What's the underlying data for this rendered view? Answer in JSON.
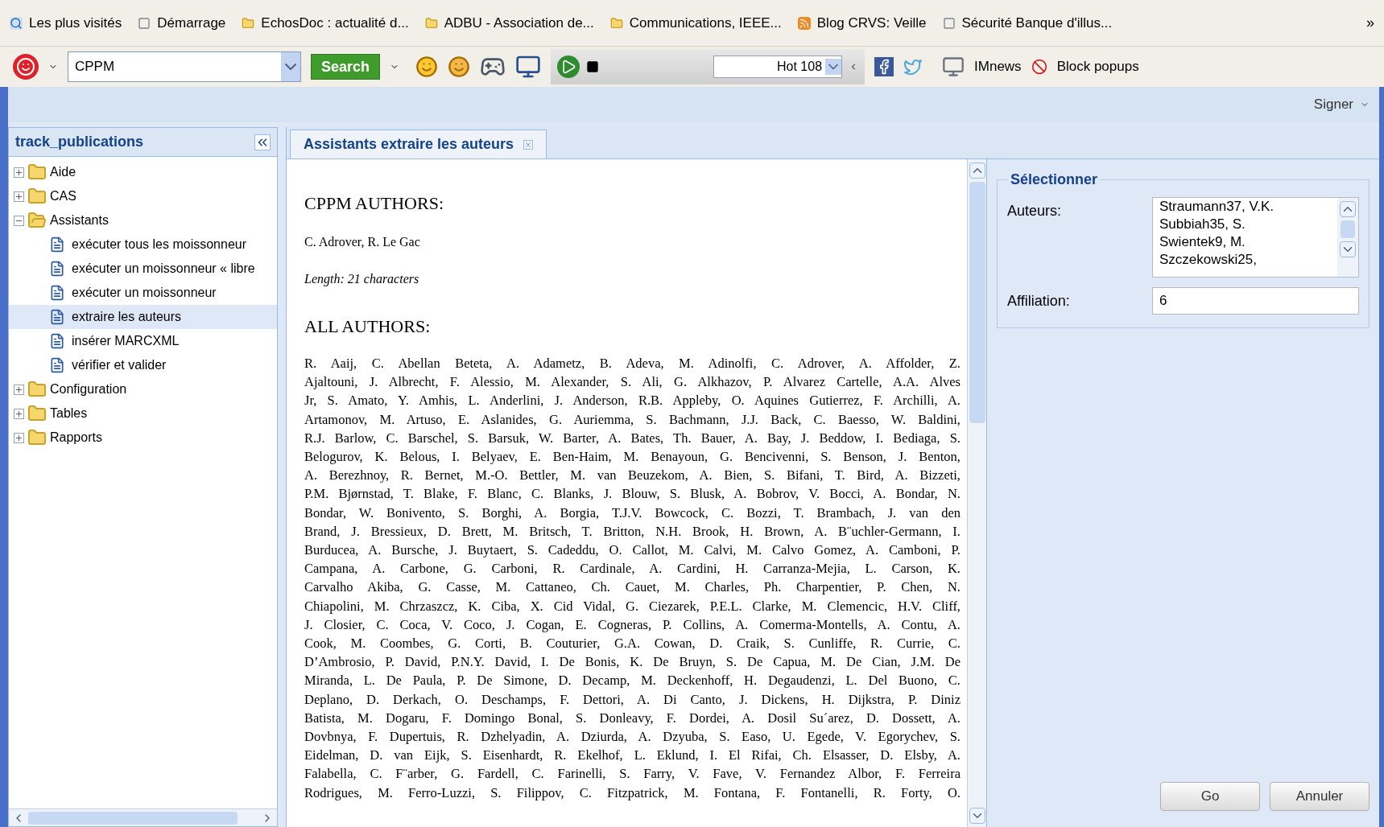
{
  "bookmarks": [
    {
      "kind": "search",
      "label": "Les plus visités"
    },
    {
      "kind": "blank",
      "label": "Démarrage"
    },
    {
      "kind": "folder",
      "label": "EchosDoc : actualité d..."
    },
    {
      "kind": "folder",
      "label": "ADBU - Association de..."
    },
    {
      "kind": "folder",
      "label": "Communications, IEEE..."
    },
    {
      "kind": "rss",
      "label": "Blog CRVS: Veille"
    },
    {
      "kind": "blank",
      "label": "Sécurité Banque d'illus..."
    }
  ],
  "bookmarks_overflow": "»",
  "toolbar": {
    "search_value": "CPPM",
    "search_button": "Search",
    "hot_value": "Hot 108",
    "imnews": "IMnews",
    "block_popups": "Block popups"
  },
  "user_menu": "Signer",
  "sidebar": {
    "title": "track_publications",
    "items": [
      {
        "label": "Aide",
        "expanded": false,
        "selected": false
      },
      {
        "label": "CAS",
        "expanded": false,
        "selected": false
      },
      {
        "label": "Assistants",
        "expanded": true,
        "selected": false,
        "children": [
          {
            "label": "exécuter tous les moissonneur",
            "selected": false
          },
          {
            "label": "exécuter un moissonneur « libre",
            "selected": false
          },
          {
            "label": "exécuter un moissonneur",
            "selected": false
          },
          {
            "label": "extraire les auteurs",
            "selected": true
          },
          {
            "label": "insérer MARCXML",
            "selected": false
          },
          {
            "label": "vérifier et valider",
            "selected": false
          }
        ]
      },
      {
        "label": "Configuration",
        "expanded": false,
        "selected": false
      },
      {
        "label": "Tables",
        "expanded": false,
        "selected": false
      },
      {
        "label": "Rapports",
        "expanded": false,
        "selected": false
      }
    ]
  },
  "tab": {
    "label": "Assistants extraire les auteurs"
  },
  "document": {
    "cppm_heading": "CPPM AUTHORS:",
    "cppm_authors": "C. Adrover, R. Le Gac",
    "length": "Length: 21 characters",
    "all_heading": "ALL AUTHORS:",
    "lines": [
      "R. Aaij, C. Abellan Beteta, A. Adametz, B. Adeva, M. Adinolfi, C. Adrover, A. Affolder, Z.",
      "Ajaltouni, J. Albrecht, F. Alessio, M. Alexander, S. Ali, G. Alkhazov, P. Alvarez Cartelle, A.A. Alves",
      "Jr, S. Amato, Y. Amhis, L. Anderlini, J. Anderson, R.B. Appleby, O. Aquines Gutierrez, F. Archilli, A.",
      "Artamonov, M. Artuso, E. Aslanides, G. Auriemma, S. Bachmann, J.J. Back, C. Baesso, W. Baldini,",
      "R.J. Barlow, C. Barschel, S. Barsuk, W. Barter, A. Bates, Th. Bauer, A. Bay, J. Beddow, I. Bediaga, S.",
      "Belogurov, K. Belous, I. Belyaev, E. Ben-Haim, M. Benayoun, G. Bencivenni, S. Benson, J. Benton,",
      "A. Berezhnoy, R. Bernet, M.-O. Bettler, M. van Beuzekom, A. Bien, S. Bifani, T. Bird, A. Bizzeti,",
      "P.M. Bjørnstad, T. Blake, F. Blanc, C. Blanks, J. Blouw, S. Blusk, A. Bobrov, V. Bocci, A. Bondar, N.",
      "Bondar, W. Bonivento, S. Borghi, A. Borgia, T.J.V. Bowcock, C. Bozzi, T. Brambach, J. van den",
      "Brand, J. Bressieux, D. Brett, M. Britsch, T. Britton, N.H. Brook, H. Brown, A. B¨uchler-Germann, I.",
      "Burducea, A. Bursche, J. Buytaert, S. Cadeddu, O. Callot, M. Calvi, M. Calvo Gomez, A. Camboni, P.",
      "Campana, A. Carbone, G. Carboni, R. Cardinale, A. Cardini, H. Carranza-Mejia, L. Carson, K.",
      "Carvalho Akiba, G. Casse, M. Cattaneo, Ch. Cauet, M. Charles, Ph. Charpentier, P. Chen, N.",
      "Chiapolini, M. Chrzaszcz, K. Ciba, X. Cid Vidal, G. Ciezarek, P.E.L. Clarke, M. Clemencic, H.V. Cliff,",
      "J. Closier, C. Coca, V. Coco, J. Cogan, E. Cogneras, P. Collins, A. Comerma-Montells, A. Contu, A.",
      "Cook, M. Coombes, G. Corti, B. Couturier, G.A. Cowan, D. Craik, S. Cunliffe, R. Currie, C.",
      "D’Ambrosio, P. David, P.N.Y. David, I. De Bonis, K. De Bruyn, S. De Capua, M. De Cian, J.M. De",
      "Miranda, L. De Paula, P. De Simone, D. Decamp, M. Deckenhoff, H. Degaudenzi, L. Del Buono, C.",
      "Deplano, D. Derkach, O. Deschamps, F. Dettori, A. Di Canto, J. Dickens, H. Dijkstra, P. Diniz",
      "Batista, M. Dogaru, F. Domingo Bonal, S. Donleavy, F. Dordei, A. Dosil Su´arez, D. Dossett, A.",
      "Dovbnya, F. Dupertuis, R. Dzhelyadin, A. Dziurda, A. Dzyuba, S. Easo, U. Egede, V. Egorychev, S.",
      "Eidelman, D. van Eijk, S. Eisenhardt, R. Ekelhof, L. Eklund, I. El Rifai, Ch. Elsasser, D. Elsby, A.",
      "Falabella, C. F¨arber, G. Fardell, C. Farinelli, S. Farry, V. Fave, V. Fernandez Albor, F. Ferreira",
      "Rodrigues, M. Ferro-Luzzi, S. Filippov, C. Fitzpatrick, M. Fontana, F. Fontanelli, R. Forty, O."
    ]
  },
  "form": {
    "legend": "Sélectionner",
    "authors_label": "Auteurs:",
    "authors": [
      "Straumann37, V.K.",
      "Subbiah35, S.",
      "Swientek9, M.",
      "Szczekowski25,"
    ],
    "affiliation_label": "Affiliation:",
    "affiliation_value": "6"
  },
  "buttons": [
    {
      "label": "Go"
    },
    {
      "label": "Annuler"
    }
  ]
}
